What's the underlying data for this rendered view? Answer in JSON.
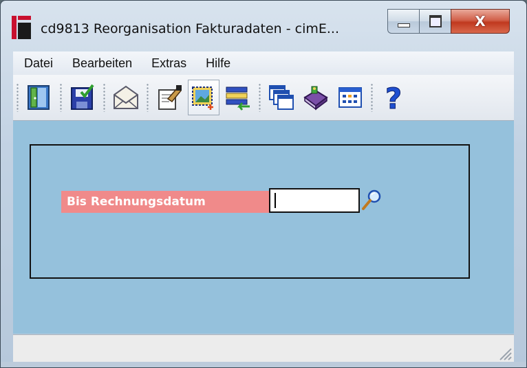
{
  "window": {
    "title": "cd9813 Reorganisation Fakturadaten - cimE...",
    "close_glyph": "X"
  },
  "menu": {
    "items": [
      "Datei",
      "Bearbeiten",
      "Extras",
      "Hilfe"
    ]
  },
  "toolbar": {
    "buttons": [
      {
        "icon": "exit-door-icon"
      },
      {
        "icon": "save-disk-icon"
      },
      {
        "icon": "mail-envelope-icon"
      },
      {
        "icon": "edit-note-icon"
      },
      {
        "icon": "new-record-icon",
        "active": true
      },
      {
        "icon": "list-transfer-icon"
      },
      {
        "icon": "windows-cascade-icon"
      },
      {
        "icon": "book-icon"
      },
      {
        "icon": "calendar-grid-icon"
      },
      {
        "icon": "help-question-icon",
        "glyph": "?"
      }
    ]
  },
  "form": {
    "field_label": "Bis Rechnungsdatum",
    "field_value": ""
  },
  "colors": {
    "client_bg": "#95c1dc",
    "label_bg": "#f08a8a",
    "close_btn": "#c0391f"
  }
}
